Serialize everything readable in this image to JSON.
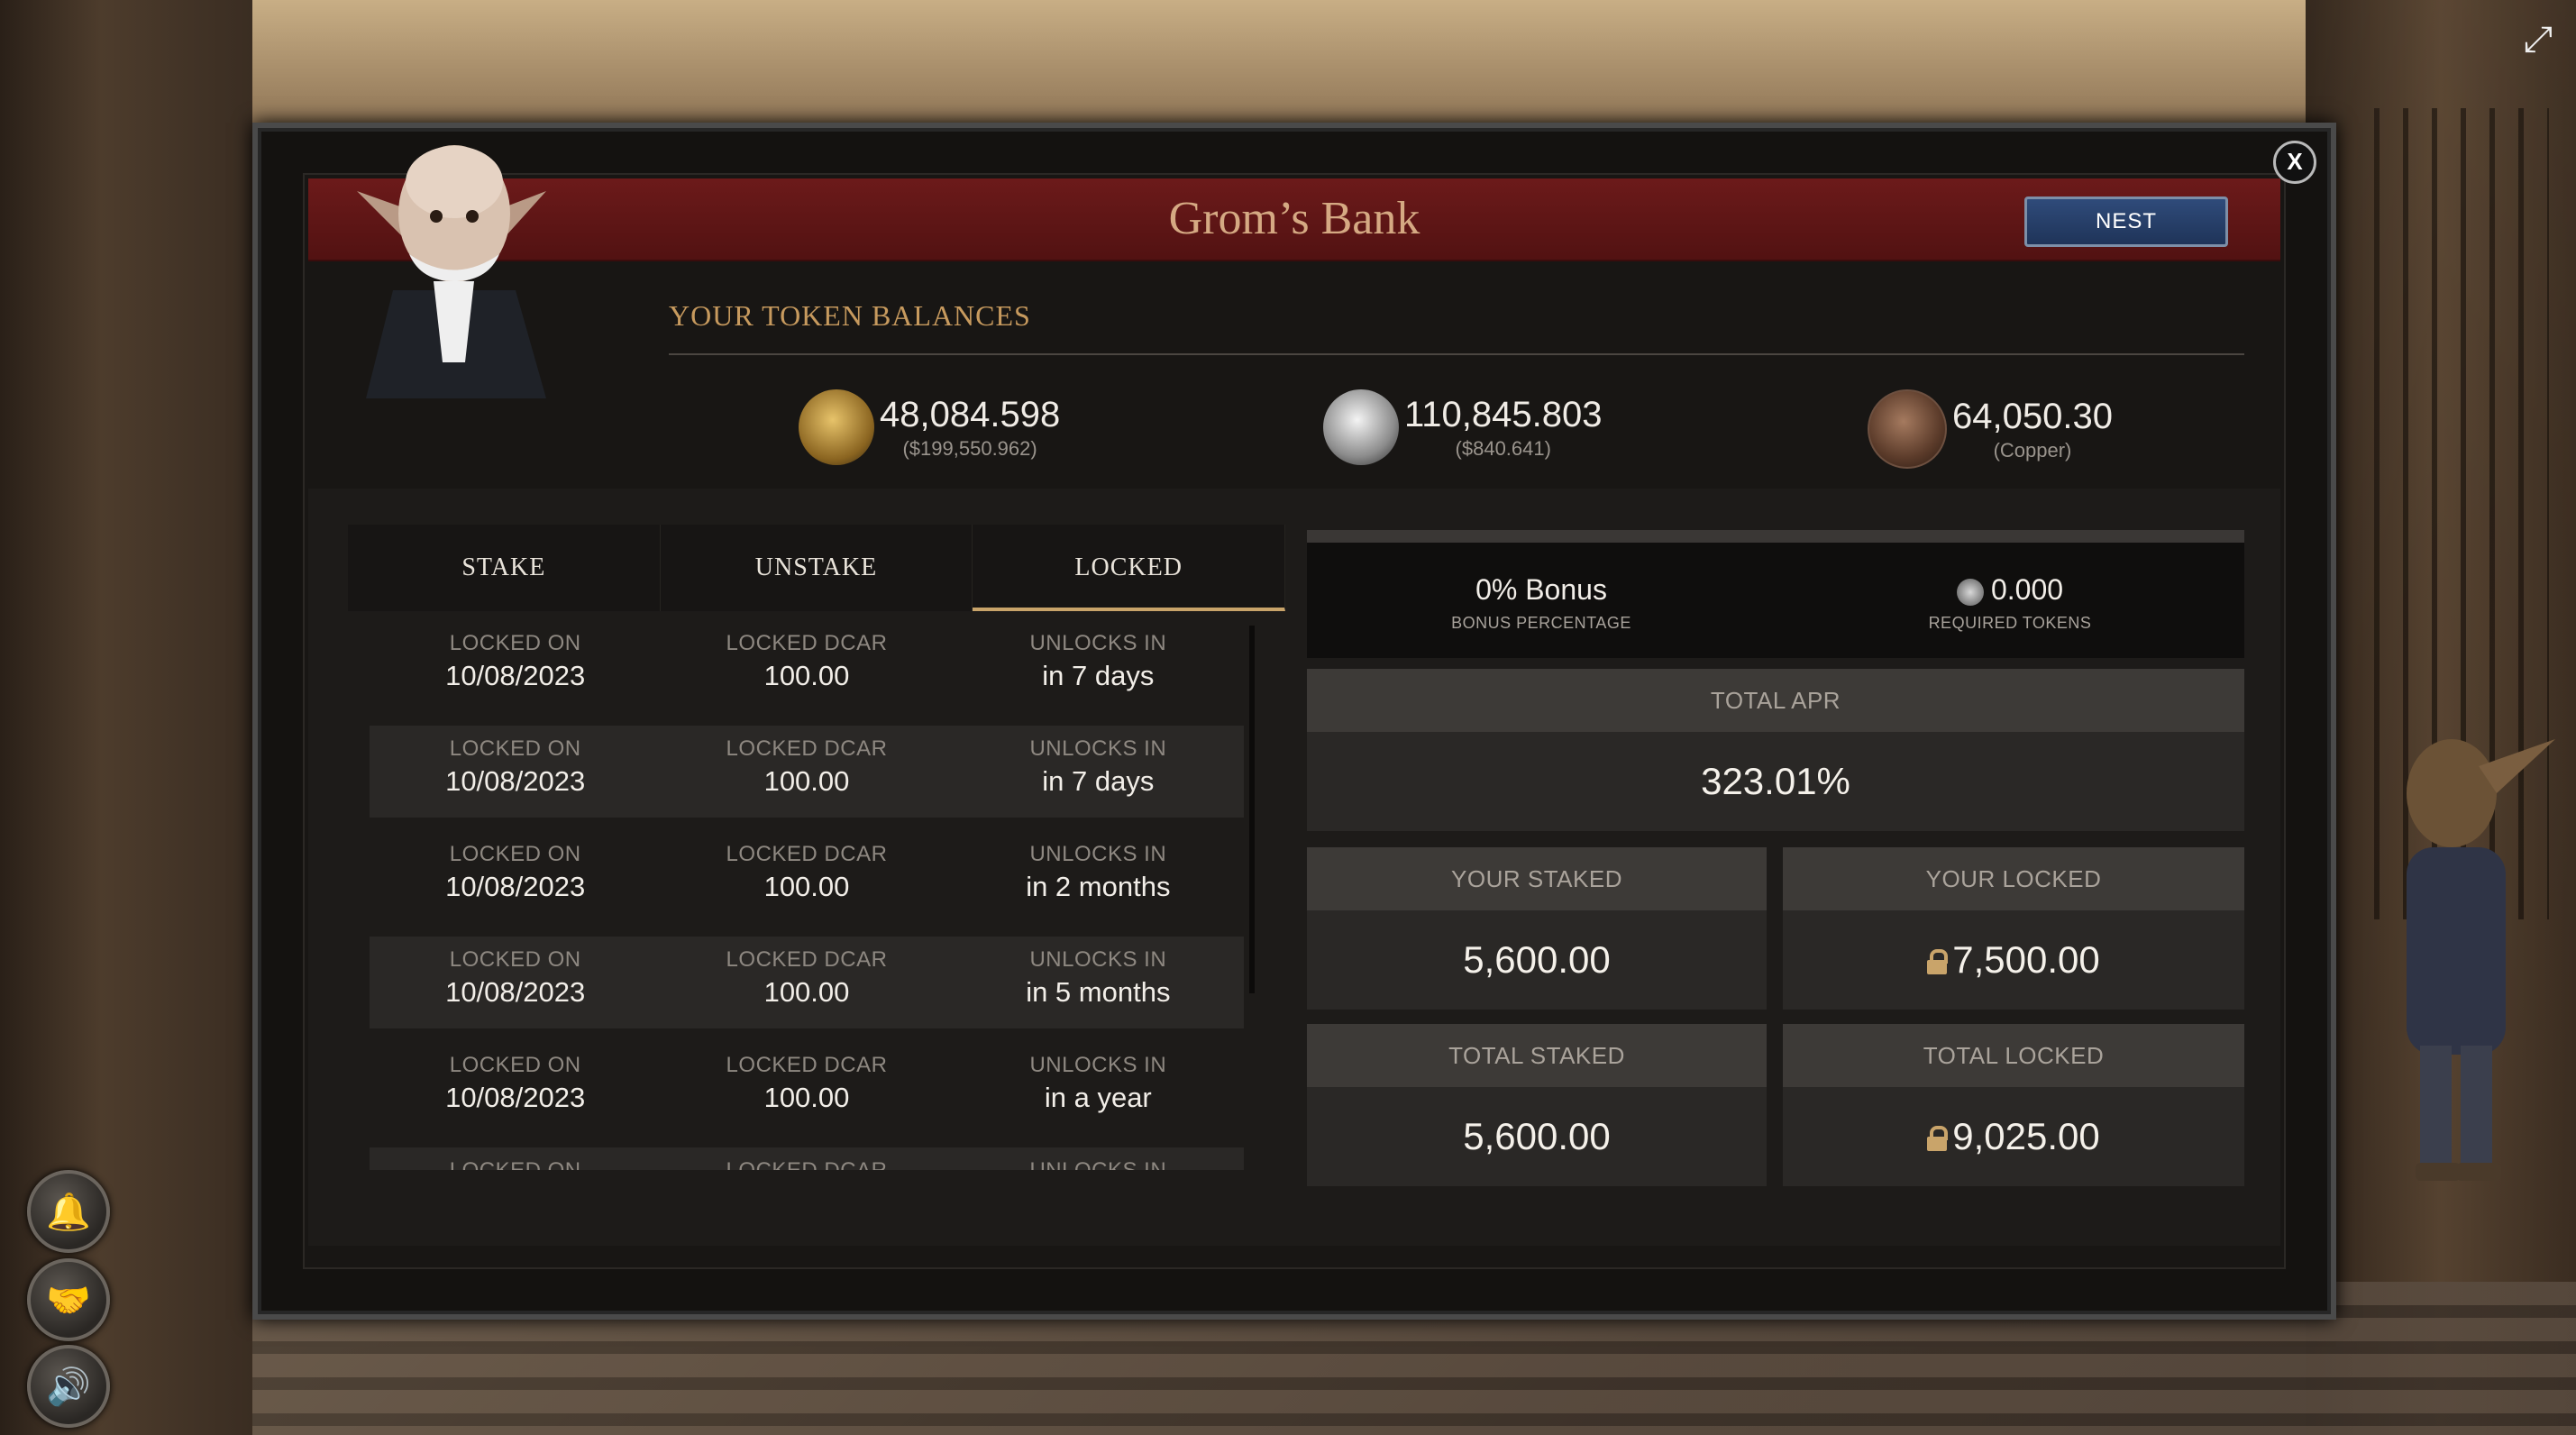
{
  "window": {
    "title": "Grom’s Bank",
    "nest_label": "NEST",
    "close_label": "X"
  },
  "balances": {
    "heading": "YOUR TOKEN BALANCES",
    "tokens": [
      {
        "amount": "48,084.598",
        "sub": "($199,550.962)",
        "icon": "gold-dragon-token-icon"
      },
      {
        "amount": "110,845.803",
        "sub": "($840.641)",
        "icon": "silver-dragon-token-icon"
      },
      {
        "amount": "64,050.30",
        "sub": "(Copper)",
        "icon": "copper-coin-icon"
      }
    ]
  },
  "tabs": [
    "STAKE",
    "UNSTAKE",
    "LOCKED"
  ],
  "active_tab": "LOCKED",
  "locked_rows": [
    {
      "locked_on_label": "LOCKED ON",
      "locked_on": "10/08/2023",
      "dcar_label": "LOCKED DCAR",
      "dcar": "100.00",
      "unlock_label": "UNLOCKS IN",
      "unlock": "in 7 days"
    },
    {
      "locked_on_label": "LOCKED ON",
      "locked_on": "10/08/2023",
      "dcar_label": "LOCKED DCAR",
      "dcar": "100.00",
      "unlock_label": "UNLOCKS IN",
      "unlock": "in 7 days"
    },
    {
      "locked_on_label": "LOCKED ON",
      "locked_on": "10/08/2023",
      "dcar_label": "LOCKED DCAR",
      "dcar": "100.00",
      "unlock_label": "UNLOCKS IN",
      "unlock": "in 2 months"
    },
    {
      "locked_on_label": "LOCKED ON",
      "locked_on": "10/08/2023",
      "dcar_label": "LOCKED DCAR",
      "dcar": "100.00",
      "unlock_label": "UNLOCKS IN",
      "unlock": "in 5 months"
    },
    {
      "locked_on_label": "LOCKED ON",
      "locked_on": "10/08/2023",
      "dcar_label": "LOCKED DCAR",
      "dcar": "100.00",
      "unlock_label": "UNLOCKS IN",
      "unlock": "in a year"
    },
    {
      "locked_on_label": "LOCKED ON",
      "locked_on": "",
      "dcar_label": "LOCKED DCAR",
      "dcar": "",
      "unlock_label": "UNLOCKS IN",
      "unlock": ""
    }
  ],
  "bonus": {
    "percentage_value": "0% Bonus",
    "percentage_label": "BONUS PERCENTAGE",
    "required_value": "0.000",
    "required_label": "REQUIRED TOKENS"
  },
  "stats": {
    "total_apr_label": "TOTAL APR",
    "total_apr": "323.01%",
    "your_staked_label": "YOUR STAKED",
    "your_staked": "5,600.00",
    "your_locked_label": "YOUR LOCKED",
    "your_locked": "7,500.00",
    "total_staked_label": "TOTAL STAKED",
    "total_staked": "5,600.00",
    "total_locked_label": "TOTAL LOCKED",
    "total_locked": "9,025.00"
  },
  "side_buttons": [
    "bell-icon",
    "handshake-icon",
    "speaker-icon"
  ],
  "colors": {
    "accent_gold": "#c9a46a",
    "title_red": "#6c1a1a",
    "nest_blue": "#2f4b7a"
  }
}
